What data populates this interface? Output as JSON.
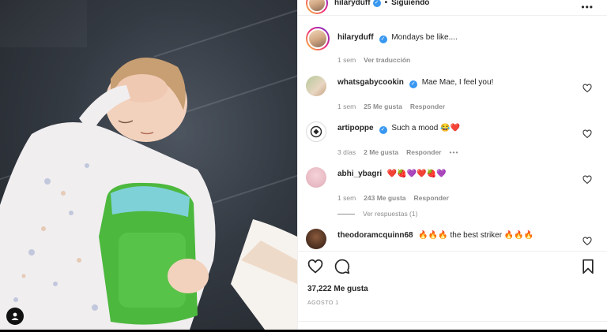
{
  "header": {
    "username": "hilaryduff",
    "separator": "•",
    "follow_label": "Siguiendo",
    "more_label": "•••"
  },
  "caption": {
    "username": "hilaryduff",
    "text": "Mondays be like....",
    "time": "1 sem",
    "translate_label": "Ver traducción"
  },
  "comments": [
    {
      "username": "whatsgabycookin",
      "verified": true,
      "text": "Mae Mae, I feel you!",
      "time": "1 sem",
      "likes": "25 Me gusta",
      "reply": "Responder"
    },
    {
      "username": "artipoppe",
      "verified": true,
      "text": "Such a mood 😂❤️",
      "time": "3 días",
      "likes": "2 Me gusta",
      "reply": "Responder",
      "more": "•••"
    },
    {
      "username": "abhi_ybagri",
      "verified": false,
      "text": "❤️🍓💜❤️🍓💜",
      "time": "1 sem",
      "likes": "243 Me gusta",
      "reply": "Responder"
    },
    {
      "username": "theodoramcquinn68",
      "verified": false,
      "text": "🔥🔥🔥 the best striker 🔥🔥🔥"
    }
  ],
  "view_replies_label": "Ver respuestas (1)",
  "likes_count": "37,222 Me gusta",
  "post_date": "AGOSTO 1",
  "icons": {
    "like": "heart-icon",
    "comment": "comment-icon",
    "save": "bookmark-icon",
    "tag": "user-tag-icon",
    "verified": "verified-badge-icon"
  },
  "colors": {
    "verified": "#3897f0",
    "text": "#262626",
    "muted": "#8e8e8e"
  }
}
